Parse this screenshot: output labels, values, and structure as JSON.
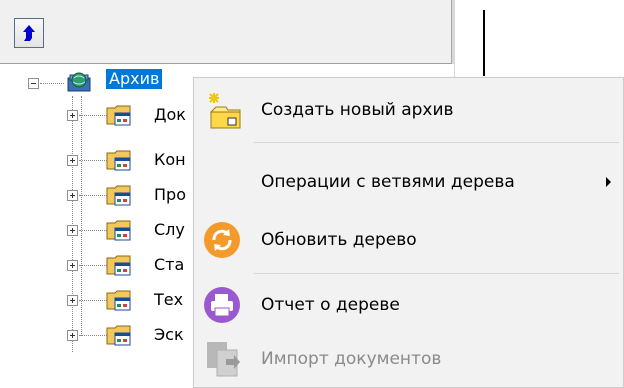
{
  "toolbar": {
    "back_icon": "arrow-up-blue-icon"
  },
  "tree": {
    "root": {
      "label": "Архив",
      "icon": "archive-globe-icon",
      "expanded": true
    },
    "children": [
      {
        "label": "Док",
        "icon": "folder-document-icon"
      },
      {
        "label": "Кон",
        "icon": "folder-document-icon"
      },
      {
        "label": "Про",
        "icon": "folder-document-icon"
      },
      {
        "label": "Слу",
        "icon": "folder-document-icon"
      },
      {
        "label": "Ста",
        "icon": "folder-document-icon"
      },
      {
        "label": "Тех",
        "icon": "folder-document-icon"
      },
      {
        "label": "Эск",
        "icon": "folder-document-icon"
      }
    ]
  },
  "context_menu": {
    "items": [
      {
        "label": "Создать новый архив",
        "icon": "new-folder-sparkle-icon",
        "enabled": true
      },
      {
        "label": "Операции с ветвями дерева",
        "icon": "",
        "enabled": true,
        "has_submenu": true
      },
      {
        "label": "Обновить дерево",
        "icon": "refresh-orange-icon",
        "enabled": true
      },
      {
        "label": "Отчет о дереве",
        "icon": "printer-purple-icon",
        "enabled": true
      },
      {
        "label": "Импорт документов",
        "icon": "import-documents-icon",
        "enabled": false
      }
    ]
  },
  "colors": {
    "selection": "#0078d7",
    "menu_background": "#f2f2f2",
    "refresh_orange": "#f39a2b",
    "report_purple": "#9b59d0"
  }
}
